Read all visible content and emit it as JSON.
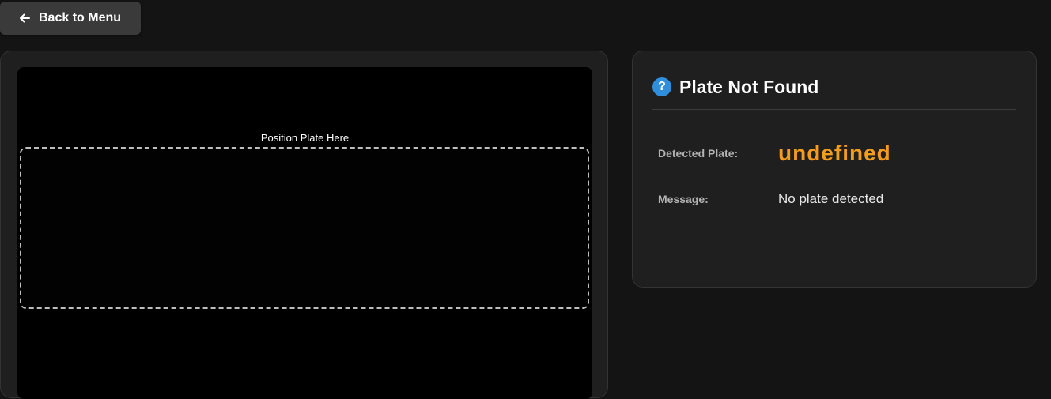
{
  "nav": {
    "back_label": "Back to Menu",
    "back_icon": "arrow-left-icon"
  },
  "camera": {
    "guide_label": "Position Plate Here"
  },
  "result": {
    "status_icon": "question-icon",
    "status_icon_glyph": "?",
    "title": "Plate Not Found",
    "detected_plate_label": "Detected Plate:",
    "detected_plate_value": "undefined",
    "message_label": "Message:",
    "message_value": "No plate detected"
  },
  "colors": {
    "background": "#141414",
    "panel": "#1f1f1f",
    "accent_plate": "#f39c1e",
    "info_icon": "#2f8fdc"
  }
}
